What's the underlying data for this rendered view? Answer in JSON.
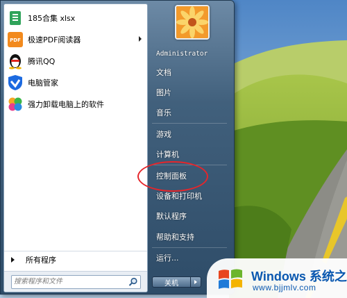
{
  "start_menu": {
    "programs": [
      {
        "label": "185合集 xlsx",
        "icon": "excel-sheet-icon",
        "has_submenu": false
      },
      {
        "label": "极速PDF阅读器",
        "icon": "pdf-reader-icon",
        "has_submenu": true
      },
      {
        "label": "腾讯QQ",
        "icon": "qq-penguin-icon",
        "has_submenu": false
      },
      {
        "label": "电脑管家",
        "icon": "shield-icon",
        "has_submenu": false
      },
      {
        "label": "强力卸载电脑上的软件",
        "icon": "clover-icon",
        "has_submenu": false
      }
    ],
    "all_programs_label": "所有程序",
    "search_placeholder": "搜索程序和文件",
    "user_name": "Administrator",
    "right_items": [
      "文档",
      "图片",
      "音乐",
      "游戏",
      "计算机",
      "控制面板",
      "设备和打印机",
      "默认程序",
      "帮助和支持",
      "运行..."
    ],
    "shutdown_label": "关机"
  },
  "watermark": {
    "title": "Windows 系统之家",
    "url": "www.bjjmlv.com"
  },
  "colors": {
    "highlight_circle": "#e5262b",
    "watermark_text": "#0a58b0"
  }
}
